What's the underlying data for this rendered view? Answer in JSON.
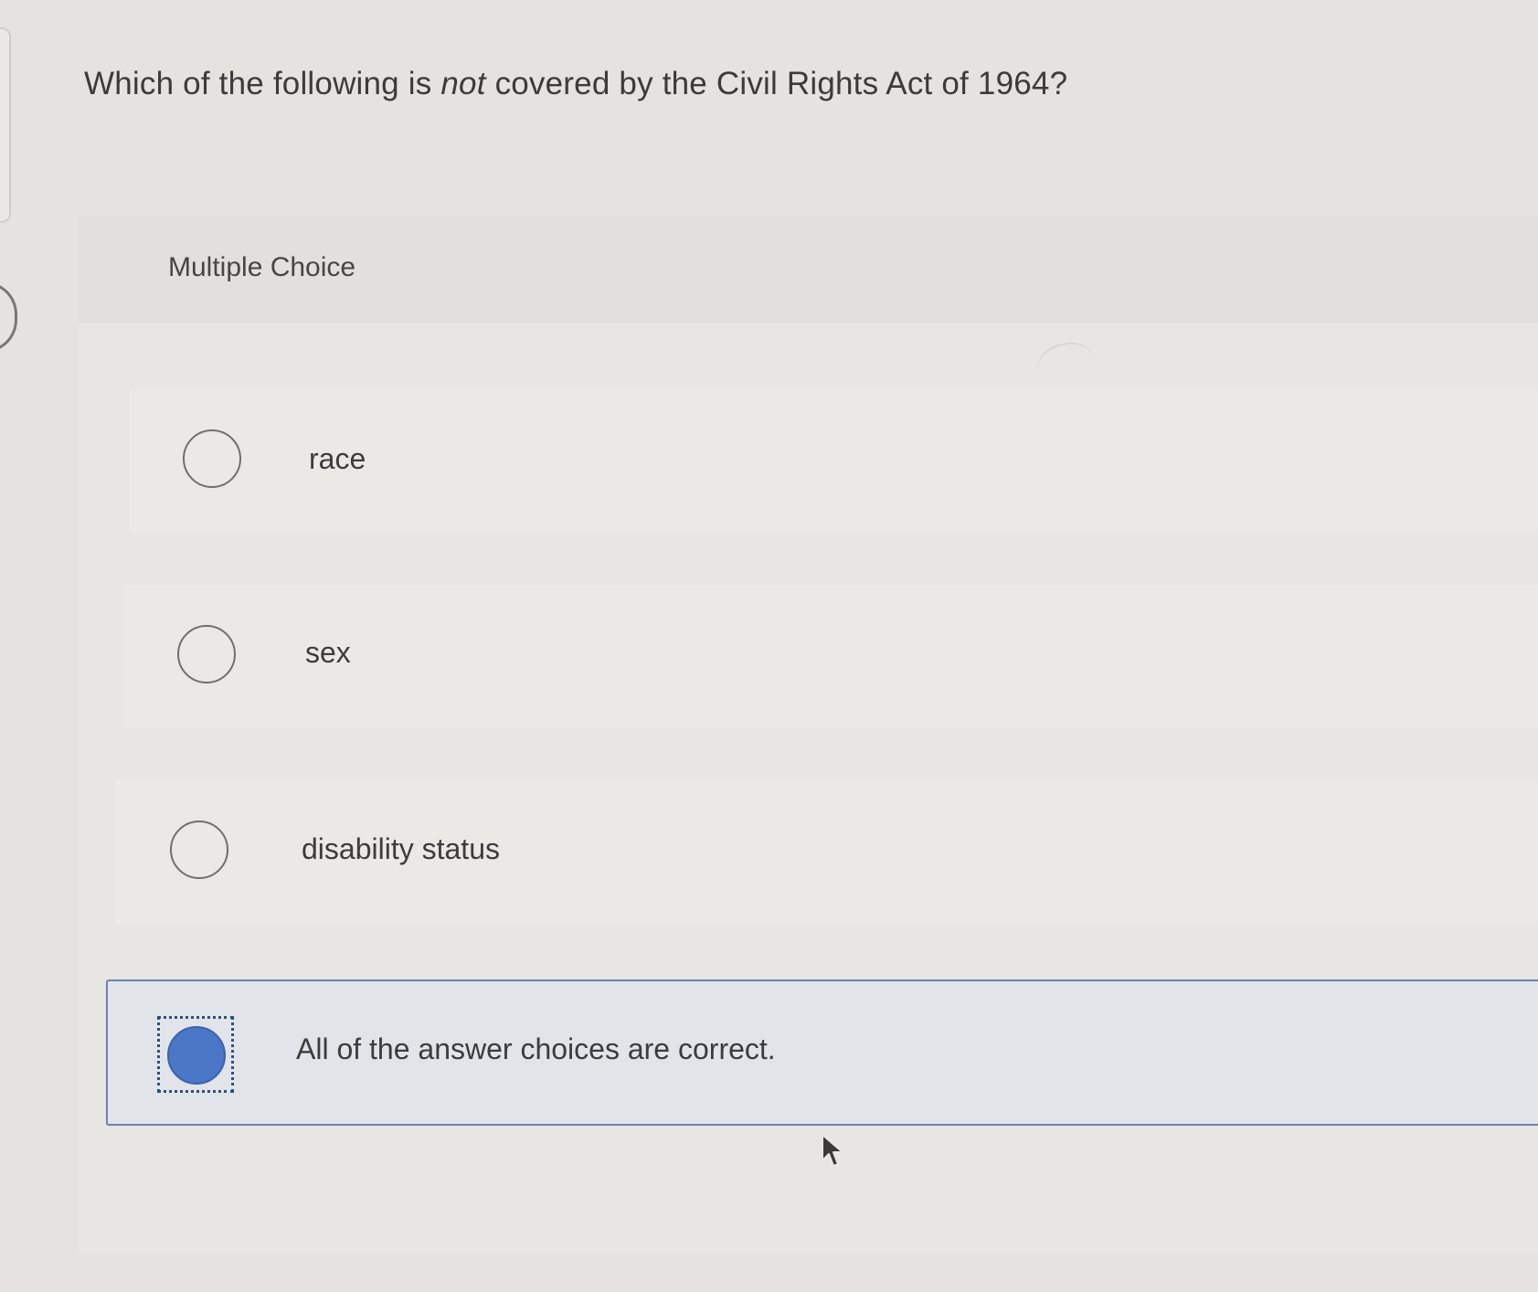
{
  "question": {
    "before": "Which of the following is ",
    "emphasis": "not",
    "after": " covered by the Civil Rights Act of 1964?"
  },
  "section_label": "Multiple Choice",
  "options": [
    {
      "label": "race",
      "selected": false
    },
    {
      "label": "sex",
      "selected": false
    },
    {
      "label": "disability status",
      "selected": false
    },
    {
      "label": "All of the answer choices are correct.",
      "selected": true
    }
  ],
  "colors": {
    "selected_fill": "#4b77c7",
    "selected_border": "#6d83ad",
    "focus_ring": "#2f4f82"
  },
  "icons": {
    "cursor": "mouse-pointer-icon"
  }
}
